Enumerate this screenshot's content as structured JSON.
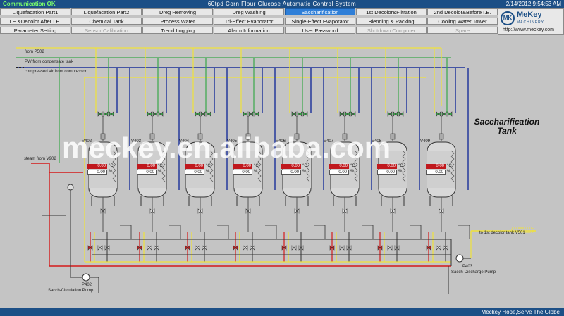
{
  "header": {
    "status": "Communication OK",
    "title": "60tpd Corn Flour Glucose Automatic Control System",
    "datetime": "2/14/2012 9:54:53 AM"
  },
  "nav": {
    "row1": [
      "Liquefacation Part1",
      "Liquefacation Part2",
      "Dreg Removing",
      "Dreg Washing",
      "Saccharification",
      "1st Decolor&Filtration",
      "2nd Decolor&Before I.E."
    ],
    "row2": [
      "I.E.&Decolor After I.E.",
      "Chemical Tank",
      "Process Water",
      "Tri-Effect Evaporator",
      "Single-Effect Evaporator",
      "Blending & Packing",
      "Cooling Water Tower"
    ],
    "row3": [
      "Parameter Setting",
      "Sensor Calibration",
      "Trend Logging",
      "Alarm Information",
      "User Password",
      "Shutdown Computer",
      "Spare"
    ]
  },
  "logo": {
    "brand": "MeKey",
    "mark": "MK",
    "sub": "MACHINERY",
    "url": "http://www.meckey.com"
  },
  "labels": {
    "from_p502": "from P502",
    "pw": "PW from condensate tank",
    "air": "compressed air from compressor",
    "steam": "steam from V902",
    "to_decolor": "to 1st decolor tank V501",
    "p402": "P402",
    "p402_name": "Sacch-Circulation Pump",
    "p403": "P403",
    "p403_name": "Sacch-Discharge Pump"
  },
  "process_title": "Saccharification Tank",
  "watermark": "meckey.en.alibaba.com",
  "tanks": [
    {
      "tag": "V402",
      "temp": "0.00",
      "level": "0.00",
      "temp_unit": "°C",
      "level_unit": "%"
    },
    {
      "tag": "V403",
      "temp": "0.00",
      "level": "0.00",
      "temp_unit": "°C",
      "level_unit": "%"
    },
    {
      "tag": "V404",
      "temp": "0.00",
      "level": "0.00",
      "temp_unit": "°C",
      "level_unit": "%"
    },
    {
      "tag": "V405",
      "temp": "0.00",
      "level": "0.00",
      "temp_unit": "°C",
      "level_unit": "%"
    },
    {
      "tag": "V406",
      "temp": "0.00",
      "level": "0.00",
      "temp_unit": "°C",
      "level_unit": "%"
    },
    {
      "tag": "V407",
      "temp": "0.00",
      "level": "0.00",
      "temp_unit": "°C",
      "level_unit": "%"
    },
    {
      "tag": "V408",
      "temp": "0.00",
      "level": "0.00",
      "temp_unit": "°C",
      "level_unit": "%"
    },
    {
      "tag": "V409",
      "temp": "0.00",
      "level": "0.00",
      "temp_unit": "°C",
      "level_unit": "%"
    }
  ],
  "footer": "Meckey Hope,Serve The Globe",
  "colors": {
    "header": "#1c4f86",
    "active_tab": "#2f7fd8",
    "yellow_line": "#f0e23a",
    "green_line": "#3aa84a",
    "blue_line": "#1a2f9a",
    "red_line": "#d41a1a",
    "background": "#c4c4c4"
  }
}
